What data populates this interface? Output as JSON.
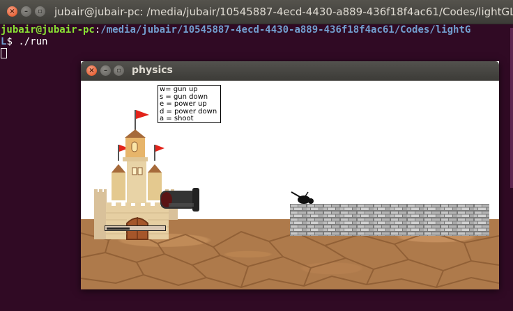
{
  "terminal": {
    "title": "jubair@jubair-pc: /media/jubair/10545887-4ecd-4430-a889-436f18f4ac61/Codes/lightGL",
    "prompt_user": "jubair@jubair-pc",
    "prompt_sep": ":",
    "prompt_path": "/media/jubair/10545887-4ecd-4430-a889-436f18f4ac61/Codes/lightG",
    "prompt_path_cont": "L",
    "prompt_symbol": "$",
    "command": "./run"
  },
  "game_window": {
    "title": "physics",
    "controls": [
      "w= gun up",
      "s = gun down",
      "e = power up",
      "d = power down",
      "a = shoot"
    ],
    "power_level": 0.4
  },
  "colors": {
    "terminal_bg": "#300a24",
    "prompt_user": "#8ae234",
    "prompt_path": "#729fcf",
    "ground": "#ae7a4b",
    "flag": "#e2231a"
  }
}
